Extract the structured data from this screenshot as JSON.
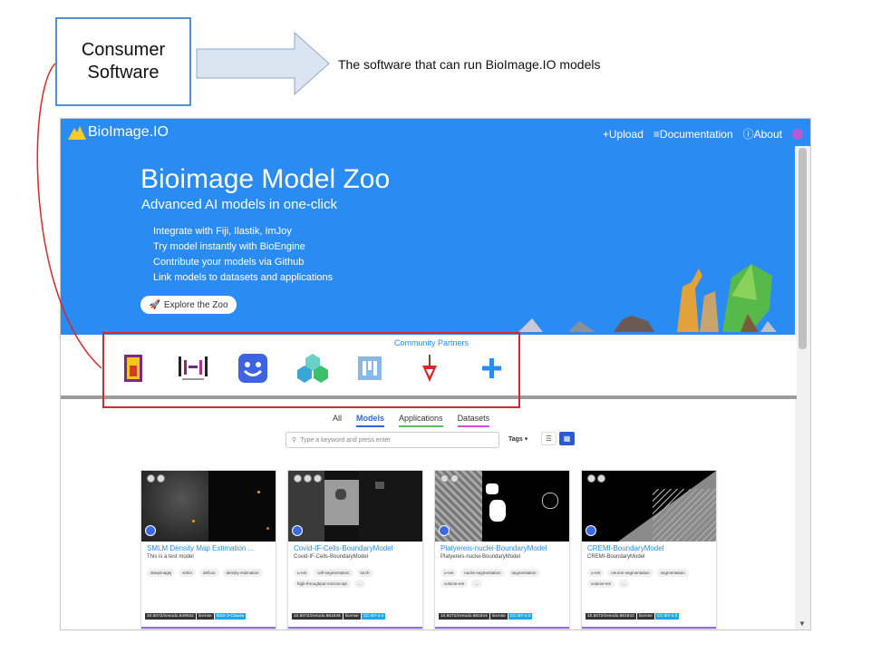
{
  "annotation": {
    "box_label_line1": "Consumer",
    "box_label_line2": "Software",
    "arrow_text": "The software that can run BioImage.IO models"
  },
  "nav": {
    "brand": "BioImage.IO",
    "links": [
      "+Upload",
      "≡Documentation",
      "ⓘAbout"
    ]
  },
  "hero": {
    "title": "Bioimage Model Zoo",
    "subtitle": "Advanced AI models in one-click",
    "bullets": [
      "Integrate with Fiji, Ilastik, ImJoy",
      "Try model instantly with BioEngine",
      "Contribute your models via Github",
      "Link models to datasets and applications"
    ],
    "cta": "Explore the Zoo"
  },
  "partners": {
    "title": "Community Partners",
    "items": [
      "fiji-icon",
      "hpa-icon",
      "imjoy-icon",
      "ilastik-icon",
      "zerocost-icon",
      "deepimagej-icon",
      "add-partner-icon"
    ]
  },
  "filter": {
    "tabs": [
      "All",
      "Models",
      "Applications",
      "Datasets"
    ],
    "active_tab": "Models",
    "search_placeholder": "Type a keyword and press enter",
    "tags_label": "Tags"
  },
  "cards": [
    {
      "title": "SMLM Density Map Estimation ...",
      "desc": "This is a test model",
      "tags": [
        "deepimagej",
        "smlm",
        "defcon",
        "density estimation"
      ],
      "doi": "10.5072/zenodo.849032",
      "license_label": "license",
      "license": "BSD-3-Clause"
    },
    {
      "title": "Covid-IF-Cells-BoundaryModel",
      "desc": "Covid-IF-Cells-BoundaryModel",
      "tags": [
        "u-net",
        "cell-segmentation",
        "torch",
        "high-throughput-microscopt",
        "..."
      ],
      "doi": "10.5072/zenodo.881846",
      "license_label": "license",
      "license": "CC-BY-4.0"
    },
    {
      "title": "Platyereis-nuclei-BoundaryModel",
      "desc": "Platyereis-nuclei-BoundaryModel",
      "tags": [
        "u-net",
        "nuclei-segmentation",
        "segmentation",
        "volume-em",
        "..."
      ],
      "doi": "10.5072/zenodo.881844",
      "license_label": "license",
      "license": "CC-BY-4.0"
    },
    {
      "title": "CREMI-BoundaryModel",
      "desc": "CREMI-BoundaryModel",
      "tags": [
        "u-net",
        "neuron-segmentation",
        "segmentation",
        "volume-em",
        "..."
      ],
      "doi": "10.5072/zenodo.881842",
      "license_label": "license",
      "license": "CC-BY-4.0"
    }
  ],
  "colors": {
    "primary": "#2a8bf2",
    "highlight": "#d62828",
    "arrow_fill": "#dbe5f1"
  }
}
